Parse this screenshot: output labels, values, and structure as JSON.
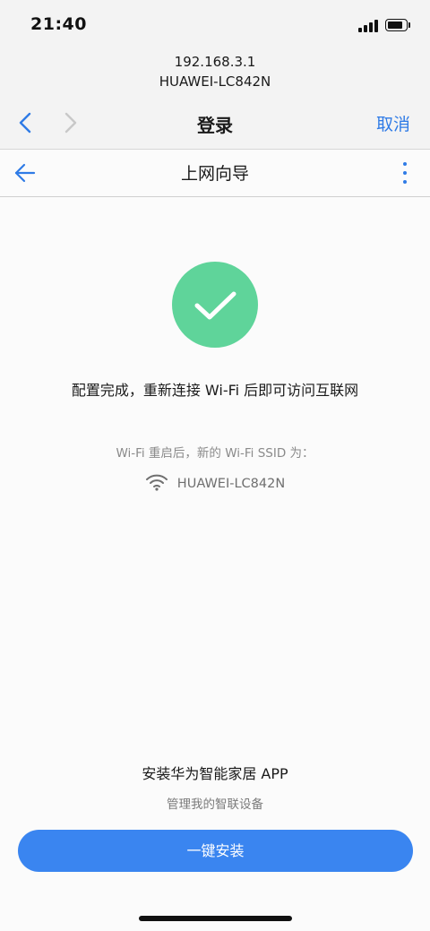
{
  "status_bar": {
    "time": "21:40"
  },
  "browser": {
    "url_ip": "192.168.3.1",
    "url_name": "HUAWEI-LC842N",
    "title": "登录",
    "cancel_label": "取消"
  },
  "app_header": {
    "title": "上网向导"
  },
  "result": {
    "message": "配置完成，重新连接 Wi-Fi 后即可访问互联网",
    "ssid_caption": "Wi-Fi 重启后，新的 Wi-Fi SSID 为：",
    "ssid": "HUAWEI-LC842N"
  },
  "install": {
    "title": "安装华为智能家居 APP",
    "subtitle": "管理我的智联设备",
    "button_label": "一键安装"
  },
  "colors": {
    "accent": "#2f7be6",
    "button": "#3a85f0",
    "success": "#5fd49a"
  },
  "icons": {
    "signal": "cellular-signal-icon",
    "battery": "battery-icon",
    "back": "chevron-left-icon",
    "forward": "chevron-right-icon",
    "app_back": "arrow-left-icon",
    "more": "more-vertical-icon",
    "success": "checkmark-icon",
    "wifi": "wifi-icon"
  }
}
